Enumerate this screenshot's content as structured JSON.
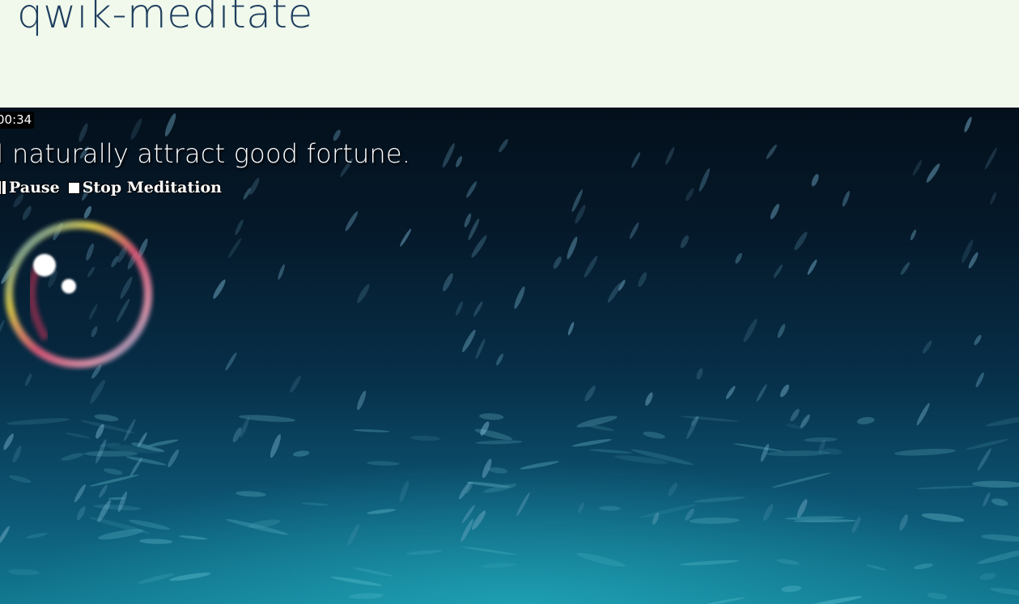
{
  "header": {
    "app_title": "qwik-meditate"
  },
  "session": {
    "timer": "00:34",
    "affirmation": "I naturally attract good fortune."
  },
  "controls": {
    "pause_label": "Pause",
    "stop_label": "Stop Meditation"
  },
  "icons": {
    "pause": "pause-icon",
    "stop": "stop-icon",
    "bubble": "breathing-bubble-icon"
  },
  "colors": {
    "header_bg": "#f0f9ec",
    "title": "#1f3e5e",
    "water_top": "#04101c",
    "water_bottom": "#127a92"
  }
}
